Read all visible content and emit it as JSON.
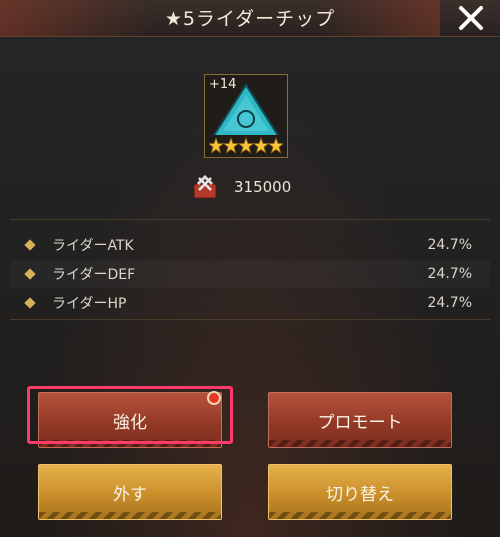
{
  "header": {
    "title": "★5ライダーチップ"
  },
  "item": {
    "level": "+14",
    "stars": 5,
    "icon": "triangle-chip-icon"
  },
  "cost": {
    "icon": "upgrade-material-icon",
    "value": "315000"
  },
  "stats": [
    {
      "label": "ライダーATK",
      "value": "24.7%"
    },
    {
      "label": "ライダーDEF",
      "value": "24.7%"
    },
    {
      "label": "ライダーHP",
      "value": "24.7%"
    }
  ],
  "buttons": {
    "enhance": "強化",
    "promote": "プロモート",
    "remove": "外す",
    "switch": "切り替え"
  },
  "colors": {
    "accent_gold": "#d6b15a",
    "highlight": "#ff3b6b",
    "button_red": "#943a26",
    "button_gold": "#c98f2b"
  }
}
